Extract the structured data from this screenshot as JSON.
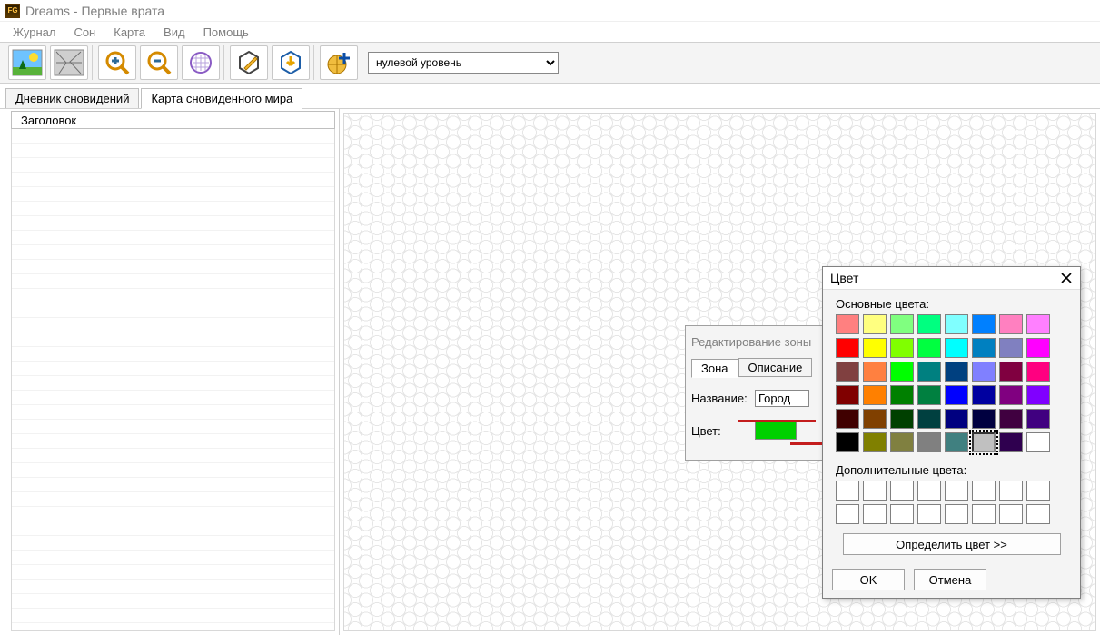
{
  "window": {
    "title": "Dreams - Первые врата"
  },
  "menu": {
    "items": [
      "Журнал",
      "Сон",
      "Карта",
      "Вид",
      "Помощь"
    ]
  },
  "toolbar": {
    "level_select": {
      "value": "нулевой уровень"
    }
  },
  "tabs": {
    "items": [
      "Дневник сновидений",
      "Карта сновиденного мира"
    ],
    "active": 1
  },
  "list": {
    "header": "Заголовок"
  },
  "zone_dialog": {
    "title": "Редактирование зоны",
    "tabs": [
      "Зона",
      "Описание"
    ],
    "name_label": "Название:",
    "name_value": "Город",
    "color_label": "Цвет:",
    "swatch_color": "#00d000"
  },
  "color_dialog": {
    "title": "Цвет",
    "basic_label": "Основные цвета:",
    "custom_label": "Дополнительные цвета:",
    "define_button": "Определить цвет >>",
    "ok": "OK",
    "cancel": "Отмена",
    "basic_colors": [
      "#ff8080",
      "#ffff80",
      "#80ff80",
      "#00ff80",
      "#80ffff",
      "#0080ff",
      "#ff80c0",
      "#ff80ff",
      "#ff0000",
      "#ffff00",
      "#80ff00",
      "#00ff40",
      "#00ffff",
      "#0080c0",
      "#8080c0",
      "#ff00ff",
      "#804040",
      "#ff8040",
      "#00ff00",
      "#008080",
      "#004080",
      "#8080ff",
      "#800040",
      "#ff0080",
      "#800000",
      "#ff8000",
      "#008000",
      "#008040",
      "#0000ff",
      "#0000a0",
      "#800080",
      "#8000ff",
      "#400000",
      "#804000",
      "#004000",
      "#004040",
      "#000080",
      "#000040",
      "#400040",
      "#400080",
      "#000000",
      "#808000",
      "#808040",
      "#808080",
      "#408080",
      "#c0c0c0",
      "#2f004f",
      "#ffffff"
    ],
    "selected_index": 45,
    "custom_colors_count": 16
  }
}
